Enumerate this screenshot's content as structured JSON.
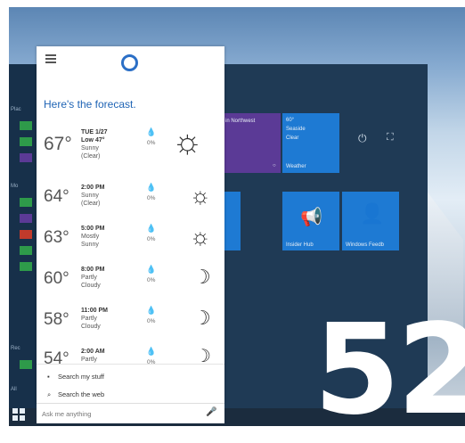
{
  "cortana": {
    "headline": "Here's the forecast.",
    "forecast": [
      {
        "temp": "67°",
        "time": "TUE 1/27",
        "low": "Low 47°",
        "condition": "Sunny",
        "detail": "(Clear)",
        "precip": "0%",
        "icon": "sun-icon"
      },
      {
        "temp": "64°",
        "time": "2:00 PM",
        "condition": "Sunny",
        "detail": "(Clear)",
        "precip": "0%",
        "icon": "sun-icon"
      },
      {
        "temp": "63°",
        "time": "5:00 PM",
        "condition": "Mostly",
        "detail": "Sunny",
        "precip": "0%",
        "icon": "sun-icon"
      },
      {
        "temp": "60°",
        "time": "8:00 PM",
        "condition": "Partly",
        "detail": "Cloudy",
        "precip": "0%",
        "icon": "moon-icon"
      },
      {
        "temp": "58°",
        "time": "11:00 PM",
        "condition": "Partly",
        "detail": "Cloudy",
        "precip": "0%",
        "icon": "moon-icon"
      },
      {
        "temp": "54°",
        "time": "2:00 AM",
        "condition": "Partly",
        "detail": "",
        "precip": "0%",
        "icon": "moon-icon"
      }
    ],
    "search_stuff": "Search my stuff",
    "search_web": "Search the web",
    "ask_placeholder": "Ask me anything"
  },
  "start": {
    "tile_northwest": "in Northwest",
    "tile_weather_temp": "60°",
    "tile_weather_place": "Seaside",
    "tile_weather_cond": "Clear",
    "tile_weather_name": "Weather",
    "tile_insider": "Insider Hub",
    "tile_feedback": "Windows Feedb",
    "left_places": "Plac",
    "left_most": "Mo",
    "left_recent": "Rec",
    "left_all": "All"
  },
  "magazine": {
    "page_number": "52"
  },
  "colors": {
    "accent": "#2b6fc6",
    "tile_blue": "#1e7ad3",
    "tile_purple": "#5b3a96",
    "start_bg": "#1f3a55"
  }
}
